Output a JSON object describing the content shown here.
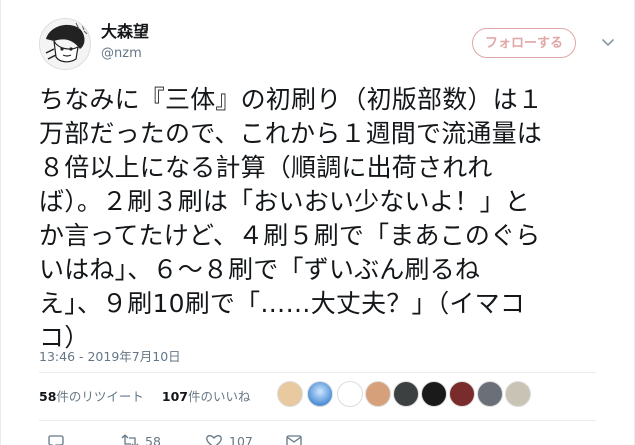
{
  "tweet": {
    "display_name": "大森望",
    "handle": "@nzm",
    "follow_label": "フォローする",
    "text_lines": [
      "ちなみに『三体』の初刷り（初版部数）は１",
      "万部だったので、これから１週間で流通量は",
      "８倍以上になる計算（順調に出荷されれ",
      "ば）。２刷３刷は「おいおい少ないよ！」と",
      "か言ってたけど、４刷５刷で「まあこのぐら",
      "いはね」、６～８刷で「ずいぶん刷るね",
      "え」、９刷10刷で「……大丈夫？」（イマコ",
      "コ）"
    ],
    "timestamp": "13:46 - 2019年7月10日",
    "retweets_count": "58",
    "retweets_label": "件のリツイート",
    "likes_count": "107",
    "likes_label": "件のいいね",
    "action_retweet_count": "58",
    "action_like_count": "107"
  },
  "icons": {
    "avatar": "manga-avatar",
    "chevron": "chevron-down-icon",
    "reply": "reply-icon",
    "retweet": "retweet-icon",
    "like": "heart-icon",
    "dm": "mail-icon"
  },
  "colors": {
    "follow_accent": "#e0a7a7",
    "muted_text": "#657786",
    "divider": "#e6ecf0"
  }
}
